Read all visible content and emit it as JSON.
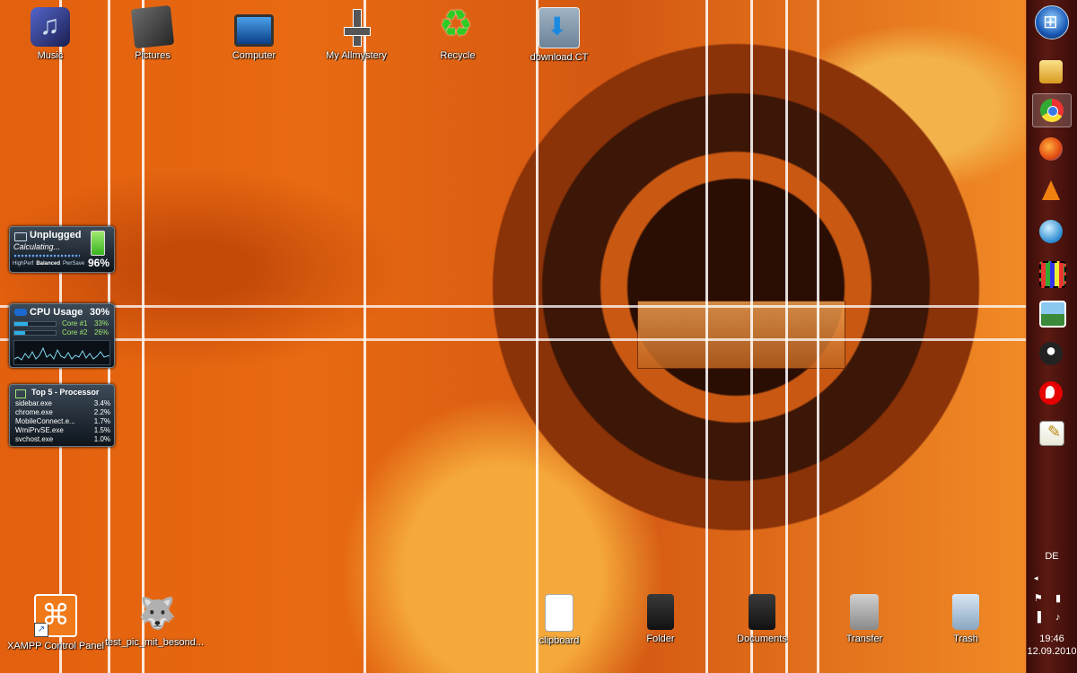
{
  "desktop": {
    "top_icons": [
      {
        "label": "Music",
        "icon": "music-folder-icon"
      },
      {
        "label": "Pictures",
        "icon": "pictures-folder-icon"
      },
      {
        "label": "Computer",
        "icon": "computer-icon"
      },
      {
        "label": "My Allmystery",
        "icon": "allmystery-icon"
      },
      {
        "label": "Recycle",
        "icon": "recycle-icon"
      },
      {
        "label": "download.CT",
        "icon": "download-icon"
      }
    ],
    "bottom_icons": [
      {
        "label": "XAMPP Control Panel",
        "icon": "xampp-icon"
      },
      {
        "label": "test_pic_mit_besond...",
        "icon": "test-pic-icon"
      },
      {
        "label": "clipboard",
        "icon": "text-file-icon"
      },
      {
        "label": "Folder",
        "icon": "black-folder-icon"
      },
      {
        "label": "Documents",
        "icon": "documents-folder-icon"
      },
      {
        "label": "Transfer",
        "icon": "transfer-drive-icon"
      },
      {
        "label": "Trash",
        "icon": "trash-bin-icon"
      }
    ]
  },
  "gadgets": {
    "battery": {
      "title": "Unplugged",
      "status": "Calculating...",
      "percent": "96%",
      "modes": [
        "HighPerf",
        "Balanced",
        "PwrSave"
      ],
      "active_mode": "Balanced"
    },
    "cpu": {
      "title": "CPU Usage",
      "total": "30%",
      "cores": [
        {
          "name": "Core #1",
          "value": "33%",
          "level": 0.33
        },
        {
          "name": "Core #2",
          "value": "26%",
          "level": 0.26
        }
      ],
      "graph_color": "#7fd8f0"
    },
    "top5": {
      "title": "Top 5 - Processor",
      "processes": [
        {
          "name": "sidebar.exe",
          "value": "3.4%"
        },
        {
          "name": "chrome.exe",
          "value": "2.2%"
        },
        {
          "name": "MobileConnect.e...",
          "value": "1.7%"
        },
        {
          "name": "WmiPrvSE.exe",
          "value": "1.5%"
        },
        {
          "name": "svchost.exe",
          "value": "1.0%"
        }
      ]
    }
  },
  "taskbar": {
    "start_icon": "windows-orb-icon",
    "items": [
      {
        "icon": "windows-explorer-icon",
        "active": false
      },
      {
        "icon": "chrome-icon",
        "active": true
      },
      {
        "icon": "firefox-icon",
        "active": false
      },
      {
        "icon": "vlc-icon",
        "active": false
      },
      {
        "icon": "globe-icon",
        "active": false
      },
      {
        "icon": "film-icon",
        "active": false
      },
      {
        "icon": "photo-viewer-icon",
        "active": false
      },
      {
        "icon": "pidgin-icon",
        "active": false
      },
      {
        "icon": "vodafone-icon",
        "active": false
      },
      {
        "icon": "notepad-icon",
        "active": false
      }
    ],
    "language": "DE",
    "tray_arrow": "◂",
    "clock_time": "19:46",
    "clock_date": "12.09.2010"
  },
  "colors": {
    "wallpaper_orange": "#e2600e",
    "taskbar_bg": "#4a140e"
  }
}
